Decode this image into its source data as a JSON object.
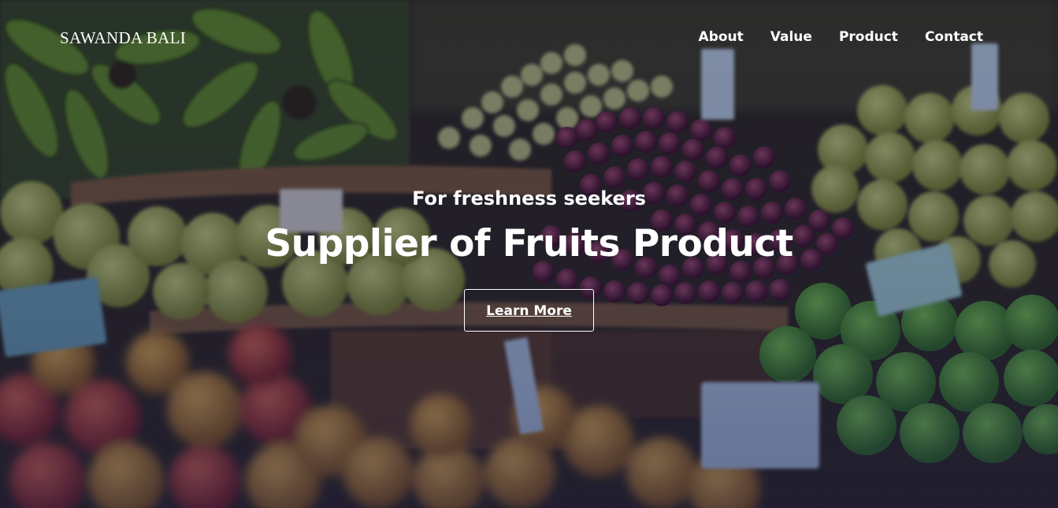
{
  "brand": {
    "name": "SAWANDA BALI"
  },
  "nav": {
    "items": [
      {
        "label": "About"
      },
      {
        "label": "Value"
      },
      {
        "label": "Product"
      },
      {
        "label": "Contact"
      }
    ]
  },
  "hero": {
    "tagline": "For freshness seekers",
    "headline": "Supplier of Fruits Product",
    "cta_label": "Learn More",
    "background_image": "fruit-market-stall",
    "overlay_color": "#1c1c4a"
  },
  "colors": {
    "text": "#ffffff",
    "banana_green": "#4f7a1e",
    "grape_purple": "#5a2438",
    "apple_green": "#3f8a2a",
    "basket_brown": "#6b4a2a"
  }
}
